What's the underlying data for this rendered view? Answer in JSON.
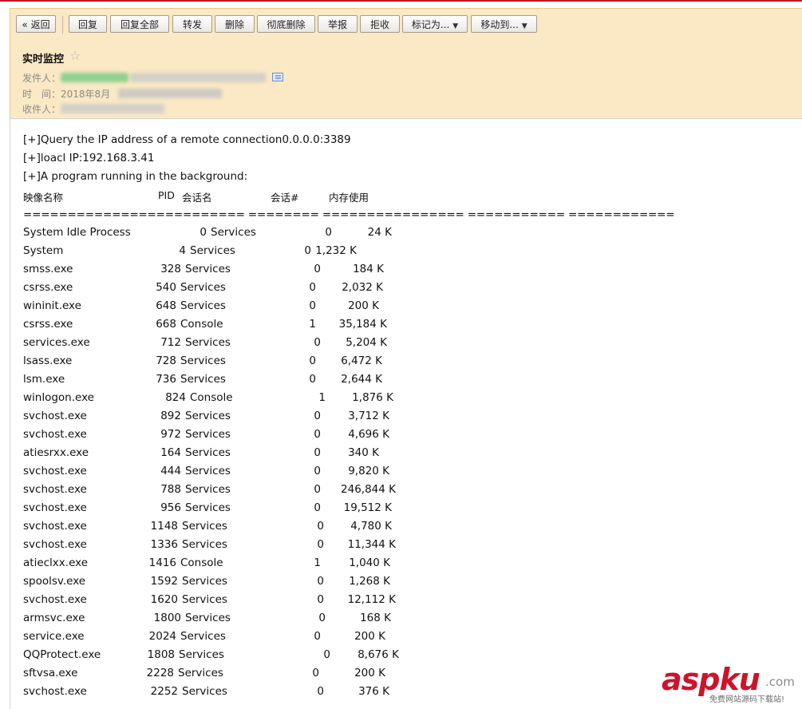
{
  "toolbar": {
    "back": "« 返回",
    "reply": "回复",
    "reply_all": "回复全部",
    "forward": "转发",
    "delete": "删除",
    "delete_permanently": "彻底删除",
    "report": "举报",
    "reject": "拒收",
    "mark_as": "标记为...",
    "move_to": "移动到..."
  },
  "mail": {
    "subject": "实时监控",
    "star_icon": "☆",
    "from_label": "发件人：",
    "time_label": "时　间：",
    "time_partial": "2018年8月",
    "to_label": "收件人："
  },
  "content": {
    "line1": "[+]Query the IP address of a remote connection0.0.0.0:3389",
    "line2": "[+]loacl IP:192.168.3.41",
    "line3": "[+]A program running in the background:",
    "col_image": "映像名称",
    "col_pid": "PID",
    "col_session_name": "会话名",
    "col_session_num": "会话#",
    "col_mem": "内存使用",
    "rule": "========================= ======== ================ =========== ============",
    "processes": [
      {
        "name": "System Idle Process",
        "pid": "0",
        "session": "Services",
        "num": "0",
        "mem": "24 K"
      },
      {
        "name": "System",
        "pid": "4",
        "session": "Services",
        "num": "0",
        "mem": "1,232 K"
      },
      {
        "name": "smss.exe",
        "pid": "328",
        "session": "Services",
        "num": "0",
        "mem": "184 K"
      },
      {
        "name": "csrss.exe",
        "pid": "540",
        "session": "Services",
        "num": "0",
        "mem": "2,032 K"
      },
      {
        "name": "wininit.exe",
        "pid": "648",
        "session": "Services",
        "num": "0",
        "mem": "200 K"
      },
      {
        "name": "csrss.exe",
        "pid": "668",
        "session": "Console",
        "num": "1",
        "mem": "35,184 K"
      },
      {
        "name": "services.exe",
        "pid": "712",
        "session": "Services",
        "num": "0",
        "mem": "5,204 K"
      },
      {
        "name": "lsass.exe",
        "pid": "728",
        "session": "Services",
        "num": "0",
        "mem": "6,472 K"
      },
      {
        "name": "lsm.exe",
        "pid": "736",
        "session": "Services",
        "num": "0",
        "mem": "2,644 K"
      },
      {
        "name": "winlogon.exe",
        "pid": "824",
        "session": "Console",
        "num": "1",
        "mem": "1,876 K"
      },
      {
        "name": "svchost.exe",
        "pid": "892",
        "session": "Services",
        "num": "0",
        "mem": "3,712 K"
      },
      {
        "name": "svchost.exe",
        "pid": "972",
        "session": "Services",
        "num": "0",
        "mem": "4,696 K"
      },
      {
        "name": "atiesrxx.exe",
        "pid": "164",
        "session": "Services",
        "num": "0",
        "mem": "340 K"
      },
      {
        "name": "svchost.exe",
        "pid": "444",
        "session": "Services",
        "num": "0",
        "mem": "9,820 K"
      },
      {
        "name": "svchost.exe",
        "pid": "788",
        "session": "Services",
        "num": "0",
        "mem": "246,844 K"
      },
      {
        "name": "svchost.exe",
        "pid": "956",
        "session": "Services",
        "num": "0",
        "mem": "19,512 K"
      },
      {
        "name": "svchost.exe",
        "pid": "1148",
        "session": "Services",
        "num": "0",
        "mem": "4,780 K"
      },
      {
        "name": "svchost.exe",
        "pid": "1336",
        "session": "Services",
        "num": "0",
        "mem": "11,344 K"
      },
      {
        "name": "atieclxx.exe",
        "pid": "1416",
        "session": "Console",
        "num": "1",
        "mem": "1,040 K"
      },
      {
        "name": "spoolsv.exe",
        "pid": "1592",
        "session": "Services",
        "num": "0",
        "mem": "1,268 K"
      },
      {
        "name": "svchost.exe",
        "pid": "1620",
        "session": "Services",
        "num": "0",
        "mem": "12,112 K"
      },
      {
        "name": "armsvc.exe",
        "pid": "1800",
        "session": "Services",
        "num": "0",
        "mem": "168 K"
      },
      {
        "name": "service.exe",
        "pid": "2024",
        "session": "Services",
        "num": "0",
        "mem": "200 K"
      },
      {
        "name": "QQProtect.exe",
        "pid": "1808",
        "session": "Services",
        "num": "0",
        "mem": "8,676 K"
      },
      {
        "name": "sftvsa.exe",
        "pid": "2228",
        "session": "Services",
        "num": "0",
        "mem": "200 K"
      },
      {
        "name": "svchost.exe",
        "pid": "2252",
        "session": "Services",
        "num": "0",
        "mem": "376 K"
      }
    ]
  },
  "watermark": {
    "main": "aspku",
    "suffix": ".com",
    "sub": "免费网站源码下载站!"
  }
}
